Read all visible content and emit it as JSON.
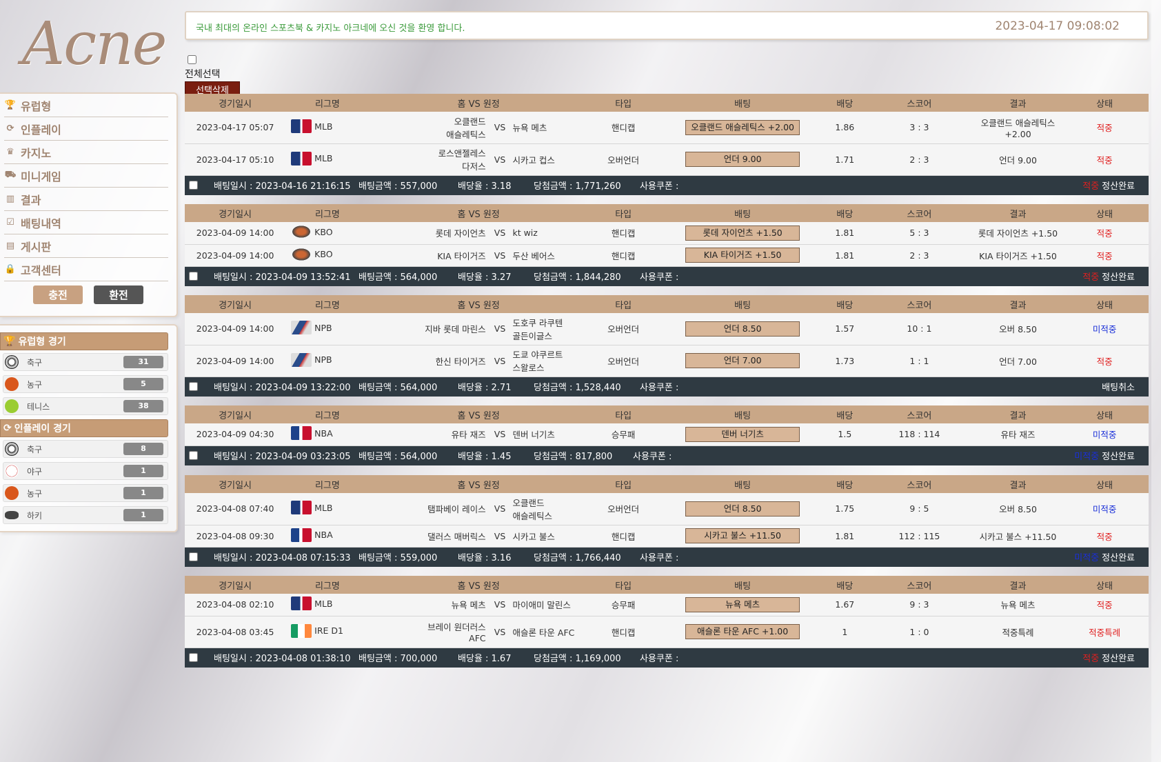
{
  "logo": "Acne",
  "welcome": {
    "message": "국내 최대의 온라인 스포츠북 & 카지노 아크네에 오신 것을 환영 합니다.",
    "datetime": "2023-04-17 09:08:02"
  },
  "menu": {
    "items": [
      {
        "label": "유럽형",
        "icon": "trophy-icon"
      },
      {
        "label": "인플레이",
        "icon": "live-icon"
      },
      {
        "label": "카지노",
        "icon": "crown-icon"
      },
      {
        "label": "미니게임",
        "icon": "cart-icon"
      },
      {
        "label": "결과",
        "icon": "chart-icon"
      },
      {
        "label": "배팅내역",
        "icon": "checklist-icon"
      },
      {
        "label": "게시판",
        "icon": "board-icon"
      },
      {
        "label": "고객센터",
        "icon": "lock-icon"
      }
    ],
    "charge_label": "충전",
    "exchange_label": "환전"
  },
  "european_games": {
    "title": "유럽형 경기",
    "items": [
      {
        "label": "축구",
        "count": "31",
        "icon": "soccer-ball-icon",
        "color": "#333333"
      },
      {
        "label": "농구",
        "count": "5",
        "icon": "basketball-icon",
        "color": "#d9571c"
      },
      {
        "label": "테니스",
        "count": "38",
        "icon": "tennis-ball-icon",
        "color": "#9acd32"
      }
    ]
  },
  "inplay_games": {
    "title": "인플레이 경기",
    "items": [
      {
        "label": "축구",
        "count": "8",
        "icon": "soccer-ball-icon",
        "color": "#333333"
      },
      {
        "label": "야구",
        "count": "1",
        "icon": "baseball-icon",
        "color": "#cccccc"
      },
      {
        "label": "농구",
        "count": "1",
        "icon": "basketball-icon",
        "color": "#d9571c"
      },
      {
        "label": "하키",
        "count": "1",
        "icon": "hockey-puck-icon",
        "color": "#444444"
      }
    ]
  },
  "select_all_label": "전체선택",
  "delete_selected_label": "선택삭제",
  "table_headers": [
    "경기일시",
    "리그명",
    "홈 VS 원정",
    "타입",
    "배팅",
    "배당",
    "스코어",
    "결과",
    "상태"
  ],
  "summary_labels": {
    "bet_date": "배팅일시 : ",
    "bet_amount": "배팅금액 : ",
    "odds_rate": "배당율 : ",
    "win_amount": "당첨금액 : ",
    "coupon": "사용쿠폰 : "
  },
  "bets": [
    {
      "rows": [
        {
          "date": "2023-04-17 05:07",
          "league": "MLB",
          "league_logo": "mlb",
          "home": "오클랜드\n애슬레틱스",
          "vs": "VS",
          "away": "뉴욕 메츠",
          "type": "핸디캡",
          "bet": "오클랜드 애슬레틱스 +2.00",
          "odds": "1.86",
          "score": "3 : 3",
          "result": "오클랜드 애슬레틱스\n+2.00",
          "state": "적중",
          "state_color": "red"
        },
        {
          "date": "2023-04-17 05:10",
          "league": "MLB",
          "league_logo": "mlb",
          "home": "로스앤젤레스\n다저스",
          "vs": "VS",
          "away": "시카고 컵스",
          "type": "오버언더",
          "bet": "언더 9.00",
          "odds": "1.71",
          "score": "2 : 3",
          "result": "언더 9.00",
          "state": "적중",
          "state_color": "red"
        }
      ],
      "bet_date": "2023-04-16 21:16:15",
      "bet_amount": "557,000",
      "odds_rate": "3.18",
      "win_amount": "1,771,260",
      "coupon": "",
      "final_state": "적중",
      "final_state_color": "red",
      "final_note": "정산완료"
    },
    {
      "rows": [
        {
          "date": "2023-04-09 14:00",
          "league": "KBO",
          "league_logo": "kbo",
          "home": "롯데 자이언츠",
          "vs": "VS",
          "away": "kt wiz",
          "type": "핸디캡",
          "bet": "롯데 자이언츠 +1.50",
          "odds": "1.81",
          "score": "5 : 3",
          "result": "롯데 자이언츠 +1.50",
          "state": "적중",
          "state_color": "red"
        },
        {
          "date": "2023-04-09 14:00",
          "league": "KBO",
          "league_logo": "kbo",
          "home": "KIA 타이거즈",
          "vs": "VS",
          "away": "두산 베어스",
          "type": "핸디캡",
          "bet": "KIA 타이거즈 +1.50",
          "odds": "1.81",
          "score": "2 : 3",
          "result": "KIA 타이거즈 +1.50",
          "state": "적중",
          "state_color": "red"
        }
      ],
      "bet_date": "2023-04-09 13:52:41",
      "bet_amount": "564,000",
      "odds_rate": "3.27",
      "win_amount": "1,844,280",
      "coupon": "",
      "final_state": "적중",
      "final_state_color": "red",
      "final_note": "정산완료"
    },
    {
      "rows": [
        {
          "date": "2023-04-09 14:00",
          "league": "NPB",
          "league_logo": "npb",
          "home": "지바 롯데 마린스",
          "vs": "VS",
          "away": "도호쿠 라쿠텐\n골든이글스",
          "type": "오버언더",
          "bet": "언더 8.50",
          "odds": "1.57",
          "score": "10 : 1",
          "result": "오버 8.50",
          "state": "미적중",
          "state_color": "blue"
        },
        {
          "date": "2023-04-09 14:00",
          "league": "NPB",
          "league_logo": "npb",
          "home": "한신 타이거즈",
          "vs": "VS",
          "away": "도쿄 야쿠르트\n스왈로스",
          "type": "오버언더",
          "bet": "언더 7.00",
          "odds": "1.73",
          "score": "1 : 1",
          "result": "언더 7.00",
          "state": "적중",
          "state_color": "red"
        }
      ],
      "bet_date": "2023-04-09 13:22:00",
      "bet_amount": "564,000",
      "odds_rate": "2.71",
      "win_amount": "1,528,440",
      "coupon": "",
      "final_state": "",
      "final_state_color": "red",
      "final_note": "배팅취소"
    },
    {
      "rows": [
        {
          "date": "2023-04-09 04:30",
          "league": "NBA",
          "league_logo": "nba",
          "home": "유타 재즈",
          "vs": "VS",
          "away": "덴버 너기츠",
          "type": "승무패",
          "bet": "덴버 너기츠",
          "odds": "1.5",
          "score": "118 : 114",
          "result": "유타 재즈",
          "state": "미적중",
          "state_color": "blue"
        }
      ],
      "bet_date": "2023-04-09 03:23:05",
      "bet_amount": "564,000",
      "odds_rate": "1.45",
      "win_amount": "817,800",
      "coupon": "",
      "final_state": "미적중",
      "final_state_color": "blue",
      "final_note": "정산완료"
    },
    {
      "rows": [
        {
          "date": "2023-04-08 07:40",
          "league": "MLB",
          "league_logo": "mlb",
          "home": "탬파베이 레이스",
          "vs": "VS",
          "away": "오클랜드\n애슬레틱스",
          "type": "오버언더",
          "bet": "언더 8.50",
          "odds": "1.75",
          "score": "9 : 5",
          "result": "오버 8.50",
          "state": "미적중",
          "state_color": "blue"
        },
        {
          "date": "2023-04-08 09:30",
          "league": "NBA",
          "league_logo": "nba",
          "home": "댈러스 매버릭스",
          "vs": "VS",
          "away": "시카고 불스",
          "type": "핸디캡",
          "bet": "시카고 불스 +11.50",
          "odds": "1.81",
          "score": "112 : 115",
          "result": "시카고 불스 +11.50",
          "state": "적중",
          "state_color": "red"
        }
      ],
      "bet_date": "2023-04-08 07:15:33",
      "bet_amount": "559,000",
      "odds_rate": "3.16",
      "win_amount": "1,766,440",
      "coupon": "",
      "final_state": "미적중",
      "final_state_color": "blue",
      "final_note": "정산완료"
    },
    {
      "rows": [
        {
          "date": "2023-04-08 02:10",
          "league": "MLB",
          "league_logo": "mlb",
          "home": "뉴욕 메츠",
          "vs": "VS",
          "away": "마이애미 말린스",
          "type": "승무패",
          "bet": "뉴욕 메츠",
          "odds": "1.67",
          "score": "9 : 3",
          "result": "뉴욕 메츠",
          "state": "적중",
          "state_color": "red"
        },
        {
          "date": "2023-04-08 03:45",
          "league": "IRE D1",
          "league_logo": "ireland-flag",
          "home": "브레이 원더러스\nAFC",
          "vs": "VS",
          "away": "애슬론 타운 AFC",
          "type": "핸디캡",
          "bet": "애슬론 타운 AFC +1.00",
          "odds": "1",
          "score": "1 : 0",
          "result": "적중특례",
          "state": "적중특례",
          "state_color": "red"
        }
      ],
      "bet_date": "2023-04-08 01:38:10",
      "bet_amount": "700,000",
      "odds_rate": "1.67",
      "win_amount": "1,169,000",
      "coupon": "",
      "final_state": "적중",
      "final_state_color": "red",
      "final_note": "정산완료"
    }
  ]
}
